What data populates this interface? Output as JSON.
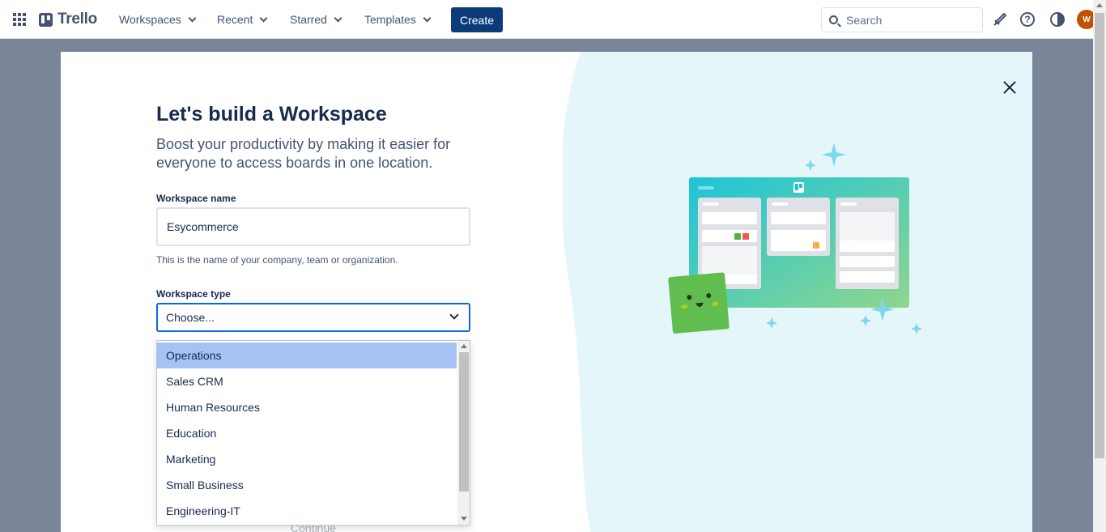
{
  "header": {
    "logo_text": "Trello",
    "nav": [
      {
        "label": "Workspaces"
      },
      {
        "label": "Recent"
      },
      {
        "label": "Starred"
      },
      {
        "label": "Templates"
      }
    ],
    "create_label": "Create",
    "search_placeholder": "Search",
    "avatar_initial": "W"
  },
  "modal": {
    "title": "Let's build a Workspace",
    "subtitle": "Boost your productivity by making it easier for everyone to access boards in one location.",
    "name_label": "Workspace name",
    "name_value": "Esycommerce",
    "name_helper": "This is the name of your company, team or organization.",
    "type_label": "Workspace type",
    "type_value": "Choose...",
    "continue_label": "Continue"
  },
  "dropdown": {
    "options": [
      {
        "label": "Operations",
        "selected": true
      },
      {
        "label": "Sales CRM"
      },
      {
        "label": "Human Resources"
      },
      {
        "label": "Education"
      },
      {
        "label": "Marketing"
      },
      {
        "label": "Small Business"
      },
      {
        "label": "Engineering-IT"
      }
    ]
  },
  "colors": {
    "accent": "#0c66e4",
    "create_button": "#0c3b7a",
    "illustration_bg": "#e5f6fa",
    "selected_option": "#a4c2f4"
  }
}
